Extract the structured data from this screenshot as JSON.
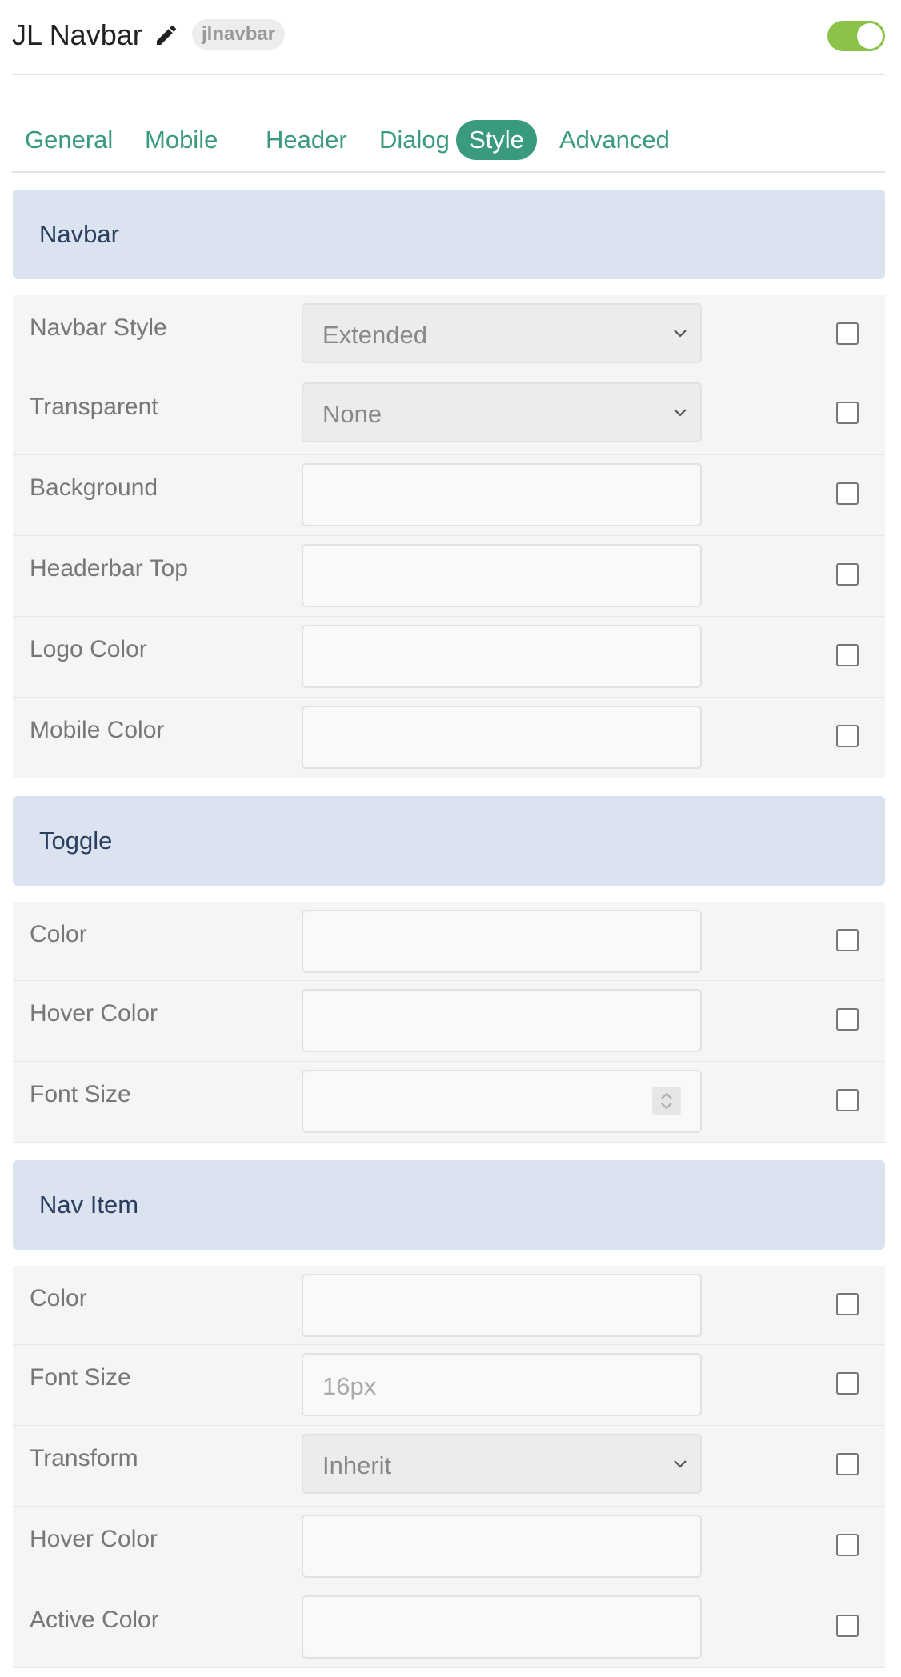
{
  "header": {
    "title": "JL Navbar",
    "alias_badge": "jlnavbar",
    "enabled": true,
    "colors": {
      "toggle_on": "#8bc34a"
    }
  },
  "tabs": [
    {
      "label": "General",
      "active": false
    },
    {
      "label": "Mobile",
      "active": false
    },
    {
      "label": "Header",
      "active": false
    },
    {
      "label": "Dialog",
      "active": false
    },
    {
      "label": "Style",
      "active": true
    },
    {
      "label": "Advanced",
      "active": false
    }
  ],
  "colors": {
    "accent": "#3a9a7f",
    "section_bg": "#dce3f0",
    "section_text": "#2a3f5f"
  },
  "sections": [
    {
      "title": "Navbar",
      "rows": [
        {
          "label": "Navbar Style",
          "type": "select",
          "value": "Extended"
        },
        {
          "label": "Transparent",
          "type": "select",
          "value": "None"
        },
        {
          "label": "Background",
          "type": "color",
          "value": ""
        },
        {
          "label": "Headerbar Top",
          "type": "color",
          "value": ""
        },
        {
          "label": "Logo Color",
          "type": "color",
          "value": ""
        },
        {
          "label": "Mobile Color",
          "type": "color",
          "value": ""
        }
      ]
    },
    {
      "title": "Toggle",
      "rows": [
        {
          "label": "Color",
          "type": "color",
          "value": ""
        },
        {
          "label": "Hover Color",
          "type": "color",
          "value": ""
        },
        {
          "label": "Font Size",
          "type": "number",
          "value": ""
        }
      ]
    },
    {
      "title": "Nav Item",
      "rows": [
        {
          "label": "Color",
          "type": "color",
          "value": ""
        },
        {
          "label": "Font Size",
          "type": "text",
          "value": "",
          "placeholder": "16px"
        },
        {
          "label": "Transform",
          "type": "select",
          "value": "Inherit"
        },
        {
          "label": "Hover Color",
          "type": "color",
          "value": ""
        },
        {
          "label": "Active Color",
          "type": "color",
          "value": ""
        }
      ]
    }
  ]
}
